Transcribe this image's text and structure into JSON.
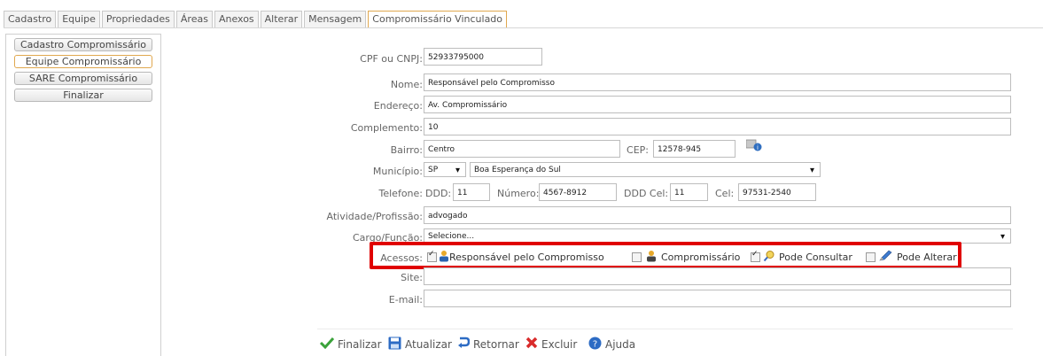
{
  "tabs": [
    "Cadastro",
    "Equipe",
    "Propriedades",
    "Áreas",
    "Anexos",
    "Alterar",
    "Mensagem",
    "Compromissário Vinculado"
  ],
  "sidebar": [
    "Cadastro Compromissário",
    "Equipe Compromissário",
    "SARE Compromissário",
    "Finalizar"
  ],
  "form": {
    "cpf_label": "CPF ou CNPJ:",
    "cpf_value": "52933795000",
    "nome_label": "Nome:",
    "nome_value": "Responsável pelo Compromisso",
    "endereco_label": "Endereço:",
    "endereco_value": "Av. Compromissário",
    "complemento_label": "Complemento:",
    "complemento_value": "10",
    "bairro_label": "Bairro:",
    "bairro_value": "Centro",
    "cep_label": "CEP:",
    "cep_value": "12578-945",
    "municipio_label": "Município:",
    "uf_value": "SP",
    "municipio_value": "Boa Esperança do Sul",
    "telefone_label": "Telefone:",
    "ddd_label": "DDD:",
    "ddd_value": "11",
    "numero_label": "Número:",
    "numero_value": "4567-8912",
    "dddcel_label": "DDD Cel:",
    "dddcel_value": "11",
    "cel_label": "Cel:",
    "cel_value": "97531-2540",
    "atividade_label": "Atividade/Profissão:",
    "atividade_value": "advogado",
    "cargo_label": "Cargo/Função:",
    "cargo_value": "Selecione...",
    "acessos_label": "Acessos:",
    "acessos": {
      "responsavel": "Responsável pelo Compromisso",
      "compromissario": "Compromissário",
      "consultar": "Pode Consultar",
      "alterar": "Pode Alterar"
    },
    "site_label": "Site:",
    "email_label": "E-mail:"
  },
  "actions": {
    "finalizar": "Finalizar",
    "atualizar": "Atualizar",
    "retornar": "Retornar",
    "excluir": "Excluir",
    "ajuda": "Ajuda"
  },
  "colors": {
    "highlight": "#e00000",
    "active_tab_border": "#e0a84f"
  }
}
